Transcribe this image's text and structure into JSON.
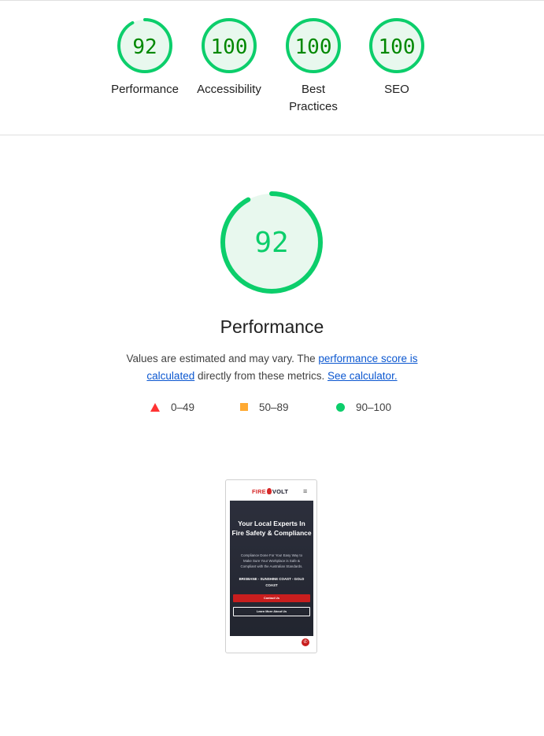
{
  "summary": {
    "categories": [
      {
        "label": "Performance",
        "score": "92",
        "value": 92
      },
      {
        "label": "Accessibility",
        "score": "100",
        "value": 100
      },
      {
        "label": "Best Practices",
        "score": "100",
        "value": 100
      },
      {
        "label": "SEO",
        "score": "100",
        "value": 100
      }
    ]
  },
  "performance": {
    "score": "92",
    "value": 92,
    "title": "Performance",
    "desc_before": "Values are estimated and may vary. The ",
    "desc_link1": "performance score is calculated",
    "desc_middle": " directly from these metrics. ",
    "desc_link2": "See calculator."
  },
  "legend": {
    "fail": "0–49",
    "average": "50–89",
    "pass": "90–100"
  },
  "colors": {
    "pass": "#0cce6b",
    "pass_text": "#008800",
    "pass_fill": "#e8f8ee",
    "average": "#ffaa33",
    "fail": "#ff3333",
    "link": "#0b57d0"
  },
  "screenshot": {
    "logo_left": "FIRE",
    "logo_right": "VOLT",
    "menu_icon": "hamburger-icon",
    "hero_title": "Your Local Experts In Fire Safety & Compliance",
    "hero_sub": "Compliance Done For You! Easy Way to Make Sure Your Workplace is Safe & Compliant with the Australian Standards.",
    "hero_locations": "BRISBANE - SUNSHINE COAST - GOLD COAST",
    "primary_button": "Contact Us",
    "secondary_button": "Learn More About Us",
    "fab_icon": "phone-icon"
  }
}
